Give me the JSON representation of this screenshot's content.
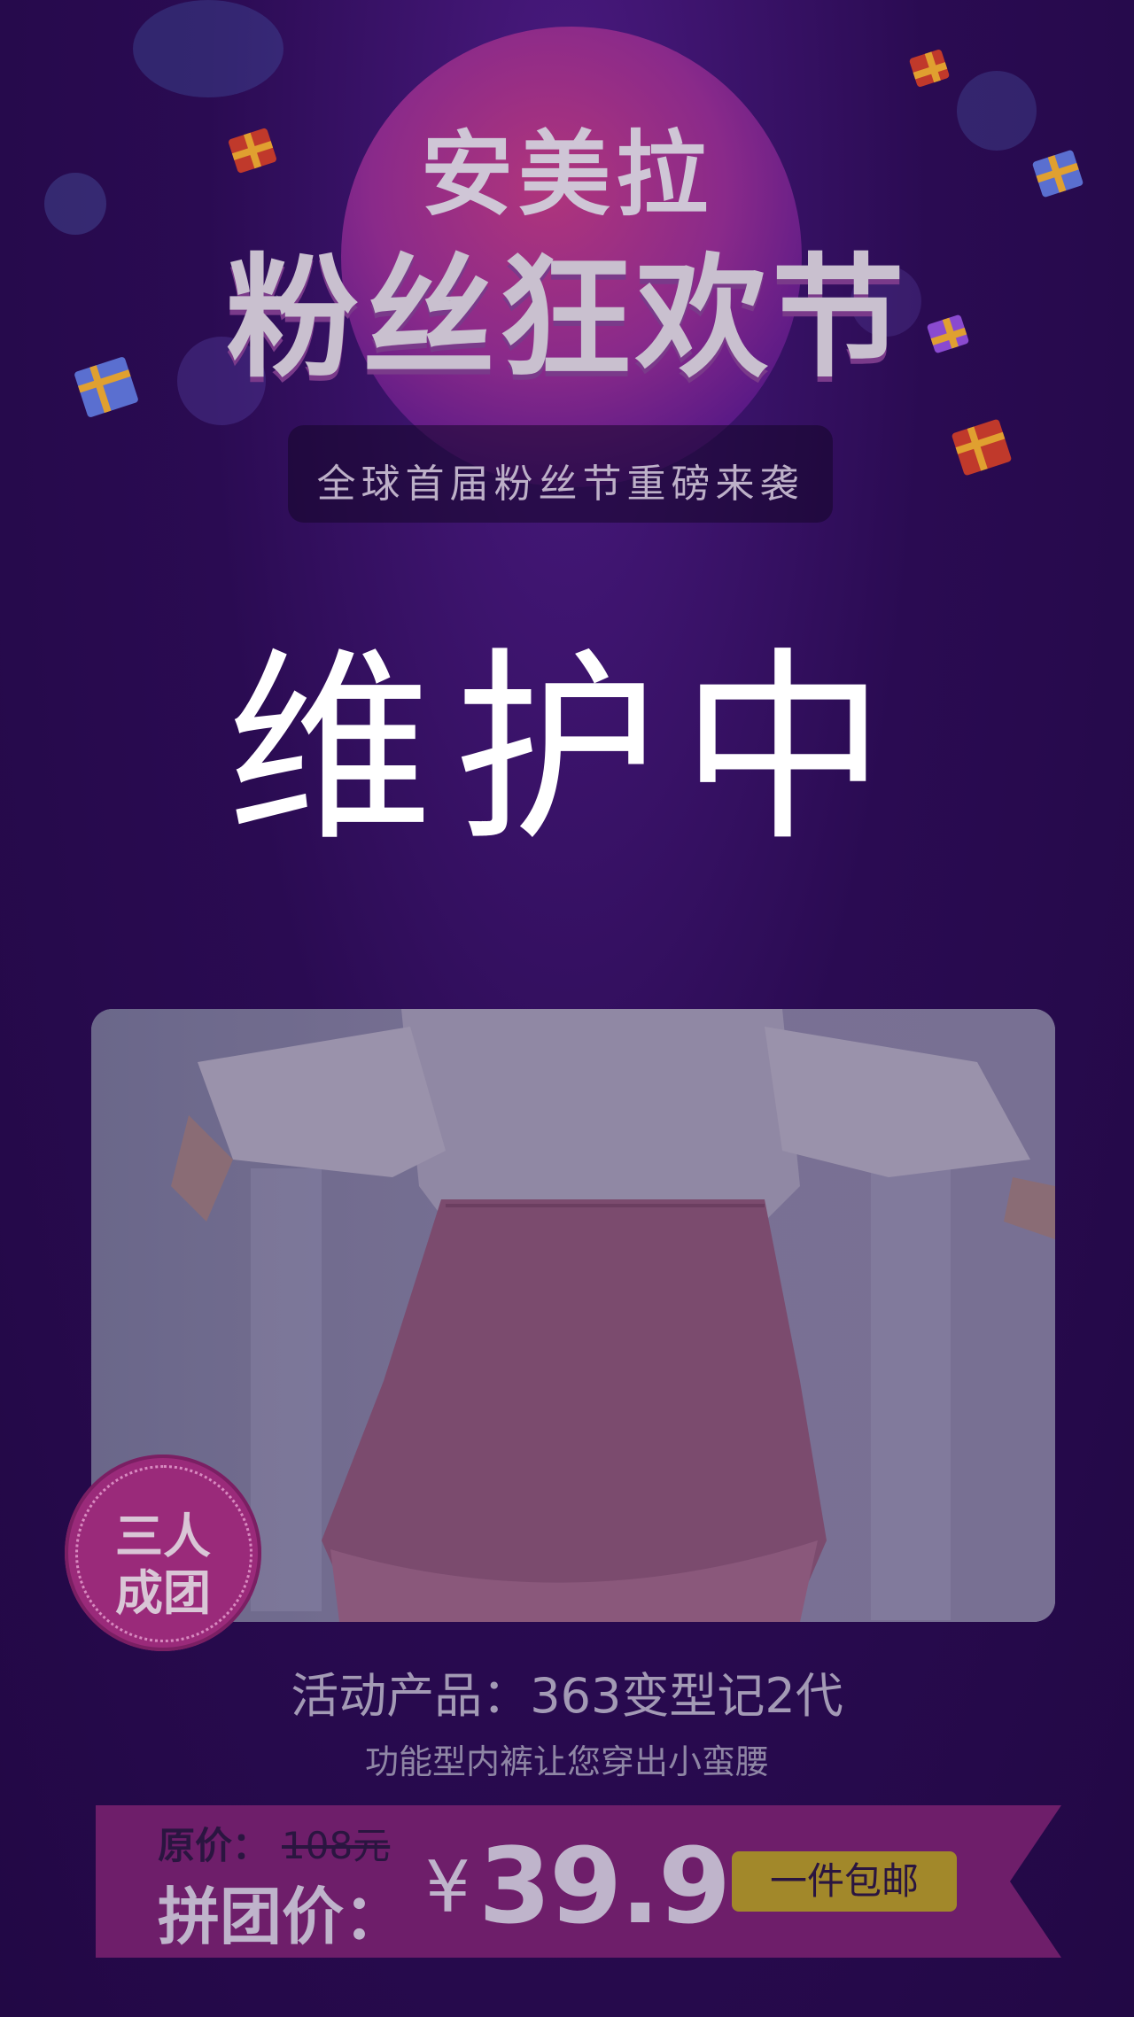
{
  "banner": {
    "title_top": "安美拉",
    "title_main": "粉丝狂欢节",
    "subtitle": "全球首届粉丝节重磅来袭"
  },
  "overlay": {
    "message": "维护中"
  },
  "product": {
    "badge_line1": "三人",
    "badge_line2": "成团",
    "name": "活动产品：363变型记2代",
    "description": "功能型内裤让您穿出小蛮腰"
  },
  "pricing": {
    "original_label": "原价：",
    "original_price": "108元",
    "group_label": "拼团价：",
    "currency": "¥",
    "group_price": "39.9",
    "shipping": "一件包邮"
  },
  "colors": {
    "background": "#2a0b52",
    "ribbon": "#6e1e6a",
    "badge": "#9a2a7a",
    "shipping_button": "#a2882a"
  }
}
